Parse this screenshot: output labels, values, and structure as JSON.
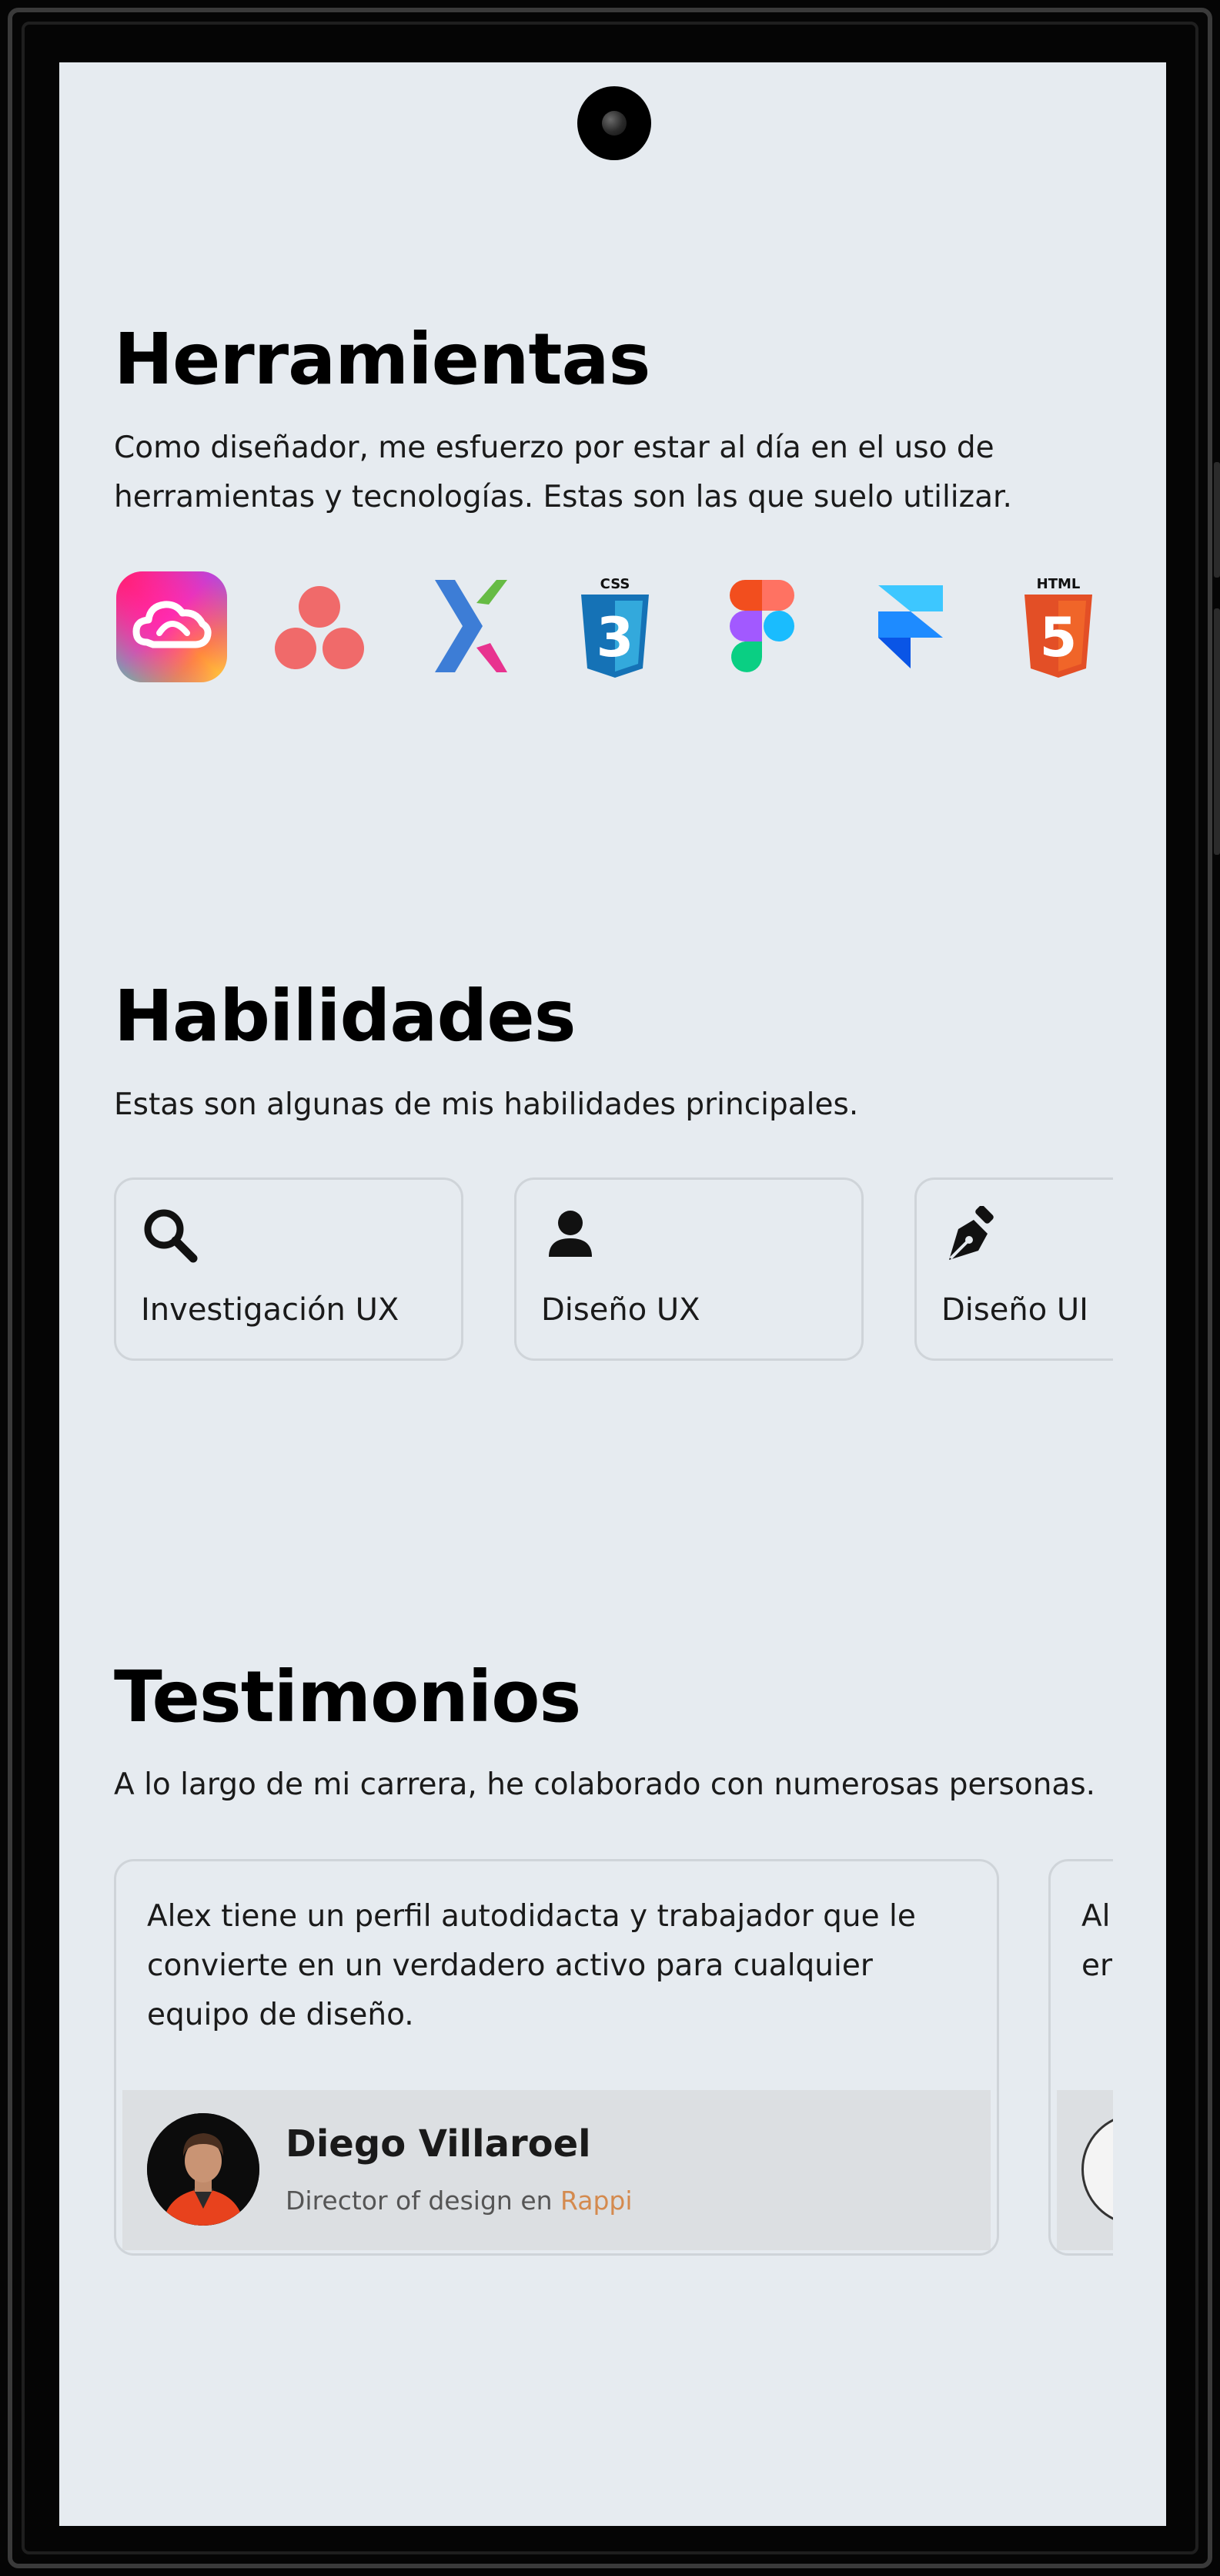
{
  "tools": {
    "title": "Herramientas",
    "description": "Como diseñador, me esfuerzo por estar al día en el uso de herramientas y tecnologías. Estas son las que suelo utilizar.",
    "items": [
      {
        "icon": "adobe-creative-cloud-icon"
      },
      {
        "icon": "asana-icon"
      },
      {
        "icon": "xd-cross-icon"
      },
      {
        "icon": "css3-icon",
        "badge": "CSS",
        "number": "3"
      },
      {
        "icon": "figma-icon"
      },
      {
        "icon": "framer-icon"
      },
      {
        "icon": "html5-icon",
        "badge": "HTML",
        "number": "5"
      }
    ]
  },
  "skills": {
    "title": "Habilidades",
    "description": "Estas son algunas de mis habilidades principales.",
    "items": [
      {
        "label": "Investigación UX",
        "icon": "search-icon"
      },
      {
        "label": "Diseño UX",
        "icon": "user-icon"
      },
      {
        "label": "Diseño UI",
        "icon": "pen-nib-icon"
      }
    ]
  },
  "testimonials": {
    "title": "Testimonios",
    "description": "A lo largo de mi carrera, he colaborado con numerosas personas.",
    "items": [
      {
        "quote": "Alex tiene un perfil autodidacta y trabajador que le convierte en un verdadero activo para cualquier equipo de diseño.",
        "name": "Diego Villaroel",
        "role_prefix": "Director of design en ",
        "company": "Rappi"
      },
      {
        "quote": "Al\ner"
      }
    ]
  },
  "colors": {
    "screen_bg": "#e6ebf0",
    "card_border": "#cfd4d9",
    "footer_bg": "#dcdfe2",
    "accent": "#d48a4e"
  }
}
